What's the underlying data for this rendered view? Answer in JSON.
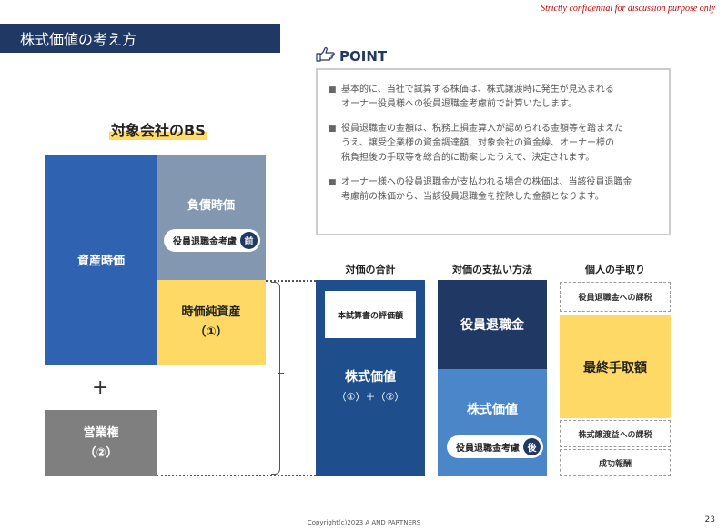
{
  "header": {
    "confidential": "Strictly confidential for discussion purpose only",
    "title": "株式価値の考え方"
  },
  "point": {
    "heading": "POINT",
    "bullet_glyph": "■",
    "items": [
      {
        "line1": "基本的に、当社で試算する株価は、株式譲渡時に発生が見込まれる",
        "line2": "オーナー役員様への役員退職金考慮前で計算いたします。",
        "line3": ""
      },
      {
        "line1": "役員退職金の金額は、税務上損金算入が認められる金額等を踏まえた",
        "line2": "うえ、譲受企業様の資金調達額、対象会社の資金繰、オーナー様の",
        "line3": "税負担後の手取等を総合的に勘案したうえで、決定されます。"
      },
      {
        "line1": "オーナー様への役員退職金が支払われる場合の株価は、当該役員退職金",
        "line2": "考慮前の株価から、当該役員退職金を控除した金額となります。",
        "line3": ""
      }
    ]
  },
  "bs": {
    "title": "対象会社のBS",
    "asset": "資産時価",
    "liability": "負債時価",
    "liability_pill": "役員退職金考慮",
    "liability_pill_badge": "前",
    "net_asset": "時価純資産",
    "net_asset_num": "（①）",
    "plus": "+",
    "goodwill": "営業権",
    "goodwill_num": "（②）"
  },
  "total": {
    "header": "対価の合計",
    "eval_box": "本試算書の評価額",
    "stock": "株式価値",
    "formula": "（①）＋（②）"
  },
  "payment": {
    "header": "対価の支払い方法",
    "retirement": "役員退職金",
    "stock": "株式価値",
    "pill": "役員退職金考慮",
    "pill_badge": "後"
  },
  "takehome": {
    "header": "個人の手取り",
    "tax_retirement": "役員退職金への課税",
    "final": "最終手取額",
    "tax_transfer": "株式譲渡益への課税",
    "fee": "成功報酬"
  },
  "footer": {
    "copyright": "Copyright(c)2023  A AND PARTNERS",
    "page": "23"
  },
  "colors": {
    "navy": "#1f3864",
    "asset_blue": "#2f62b0",
    "liability_gray": "#8497b0",
    "yellow": "#ffd966",
    "goodwill_gray": "#7f7f7f",
    "light_blue": "#4a86c8",
    "confidential_red": "#c00000"
  },
  "icons": [
    "pointing-hand-icon"
  ]
}
